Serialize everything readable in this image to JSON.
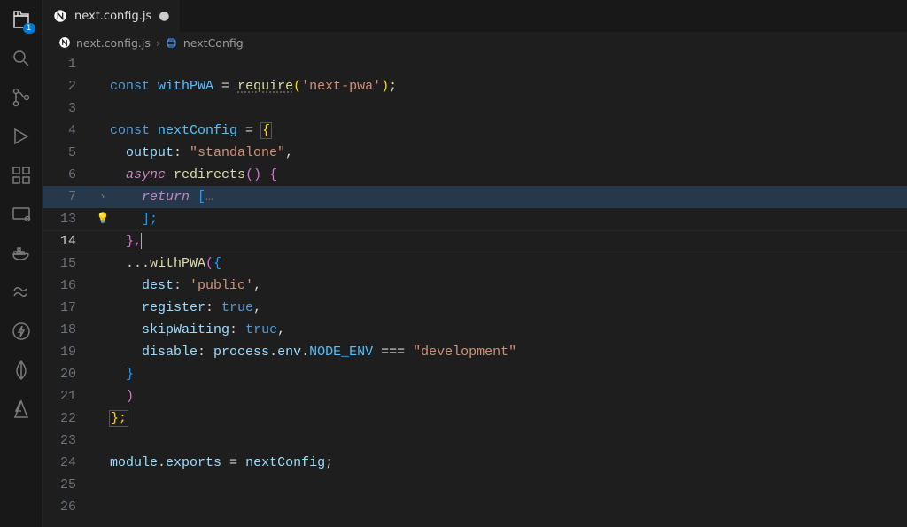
{
  "activity": {
    "explorer_badge": "1"
  },
  "tab": {
    "file_name": "next.config.js"
  },
  "breadcrumb": {
    "file": "next.config.js",
    "symbol": "nextConfig"
  },
  "gutter": {
    "lines": [
      "1",
      "2",
      "3",
      "4",
      "5",
      "6",
      "7",
      "13",
      "14",
      "15",
      "16",
      "17",
      "18",
      "19",
      "20",
      "21",
      "22",
      "23",
      "24",
      "25",
      "26"
    ],
    "current_line_index": 8,
    "fold_chevron_index": 6,
    "bulb_index": 7,
    "highlight_index": 6
  },
  "code": {
    "l2": {
      "kw": "const",
      "var": "withPWA",
      "eq": " = ",
      "fn": "require",
      "lp": "(",
      "str": "'next-pwa'",
      "rp": ")",
      "semi": ";"
    },
    "l4": {
      "kw": "const",
      "var": "nextConfig",
      "eq": " = ",
      "lb": "{"
    },
    "l5": {
      "prop": "output",
      "colon": ": ",
      "str": "\"standalone\"",
      "comma": ","
    },
    "l6": {
      "async": "async",
      "fn": "redirects",
      "call": "() ",
      "lb": "{"
    },
    "l7": {
      "ret": "return",
      "lb": " [",
      "dots": "…"
    },
    "l13": {
      "rb": "];"
    },
    "l14": {
      "rb": "},"
    },
    "l15": {
      "spread": "...",
      "fn": "withPWA",
      "lp": "(",
      "lb": "{"
    },
    "l16": {
      "prop": "dest",
      "colon": ": ",
      "str": "'public'",
      "comma": ","
    },
    "l17": {
      "prop": "register",
      "colon": ": ",
      "val": "true",
      "comma": ","
    },
    "l18": {
      "prop": "skipWaiting",
      "colon": ": ",
      "val": "true",
      "comma": ","
    },
    "l19": {
      "prop": "disable",
      "colon": ": ",
      "obj": "process",
      "dot1": ".",
      "env": "env",
      "dot2": ".",
      "node": "NODE_ENV",
      "eq": " === ",
      "str": "\"development\""
    },
    "l20": {
      "rb": "}"
    },
    "l21": {
      "rp": ")"
    },
    "l22": {
      "rb": "};"
    },
    "l24": {
      "mod": "module",
      "dot": ".",
      "exp": "exports",
      "eq": " = ",
      "var": "nextConfig",
      "semi": ";"
    }
  }
}
